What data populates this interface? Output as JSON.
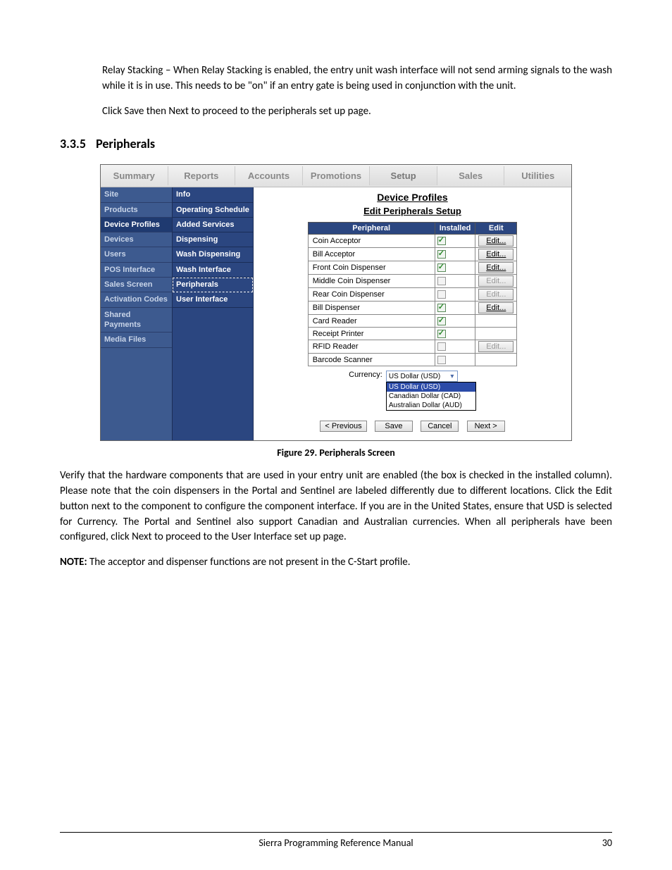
{
  "intro": {
    "p1": "Relay Stacking – When Relay Stacking is enabled, the entry unit wash interface will not send arming signals to the wash while it is in use. This needs to be \"on\" if an entry gate is being used in conjunction with the unit.",
    "p2": "Click Save then Next to proceed to the peripherals set up page."
  },
  "section": {
    "number": "3.3.5",
    "title": "Peripherals"
  },
  "app": {
    "top_tabs": [
      "Summary",
      "Reports",
      "Accounts",
      "Promotions",
      "Setup",
      "Sales",
      "Utilities"
    ],
    "active_top_tab": "Setup",
    "left_nav": [
      "Site",
      "Products",
      "Device Profiles",
      "Devices",
      "Users",
      "POS Interface",
      "Sales Screen",
      "Activation Codes",
      "Shared Payments",
      "Media Files"
    ],
    "active_left": "Device Profiles",
    "mid_nav": [
      "Info",
      "Operating Schedule",
      "Added Services",
      "Dispensing",
      "Wash Dispensing",
      "Wash Interface",
      "Peripherals",
      "User Interface"
    ],
    "active_mid": "Peripherals",
    "content_title": "Device Profiles",
    "content_subtitle": "Edit Peripherals Setup",
    "table_headers": [
      "Peripheral",
      "Installed",
      "Edit"
    ],
    "rows": [
      {
        "name": "Coin Acceptor",
        "installed": true,
        "edit": true,
        "btn": "Edit..."
      },
      {
        "name": "Bill Acceptor",
        "installed": true,
        "edit": true,
        "btn": "Edit..."
      },
      {
        "name": "Front Coin Dispenser",
        "installed": true,
        "edit": true,
        "btn": "Edit..."
      },
      {
        "name": "Middle Coin Dispenser",
        "installed": false,
        "edit": false,
        "btn": "Edit..."
      },
      {
        "name": "Rear Coin Dispenser",
        "installed": false,
        "edit": false,
        "btn": "Edit..."
      },
      {
        "name": "Bill Dispenser",
        "installed": true,
        "edit": true,
        "btn": "Edit..."
      },
      {
        "name": "Card Reader",
        "installed": true,
        "edit": null,
        "btn": ""
      },
      {
        "name": "Receipt Printer",
        "installed": true,
        "edit": null,
        "btn": ""
      },
      {
        "name": "RFID Reader",
        "installed": false,
        "edit": false,
        "btn": "Edit..."
      },
      {
        "name": "Barcode Scanner",
        "installed": false,
        "edit": null,
        "btn": ""
      }
    ],
    "currency_label": "Currency:",
    "currency_selected": "US Dollar (USD)",
    "currency_options": [
      "US Dollar (USD)",
      "Canadian Dollar (CAD)",
      "Australian Dollar (AUD)"
    ],
    "actions": {
      "prev": "< Previous",
      "save": "Save",
      "cancel": "Cancel",
      "next": "Next >"
    }
  },
  "figure_caption": "Figure 29. Peripherals Screen",
  "body": {
    "p1": "Verify that the hardware components that are used in your entry unit are enabled (the box is checked in the installed column). Please note that the coin dispensers in the Portal and Sentinel are labeled differently due to different locations. Click the Edit button next to the component to configure the component interface. If you are in the United States, ensure that USD is selected for Currency. The Portal and Sentinel also support Canadian and Australian currencies. When all peripherals have been configured, click Next to proceed to the User Interface set up page.",
    "note_label": "NOTE:",
    "note_text": " The acceptor and dispenser functions are not present in the C-Start profile."
  },
  "footer": {
    "title": "Sierra Programming Reference Manual",
    "page": "30"
  }
}
